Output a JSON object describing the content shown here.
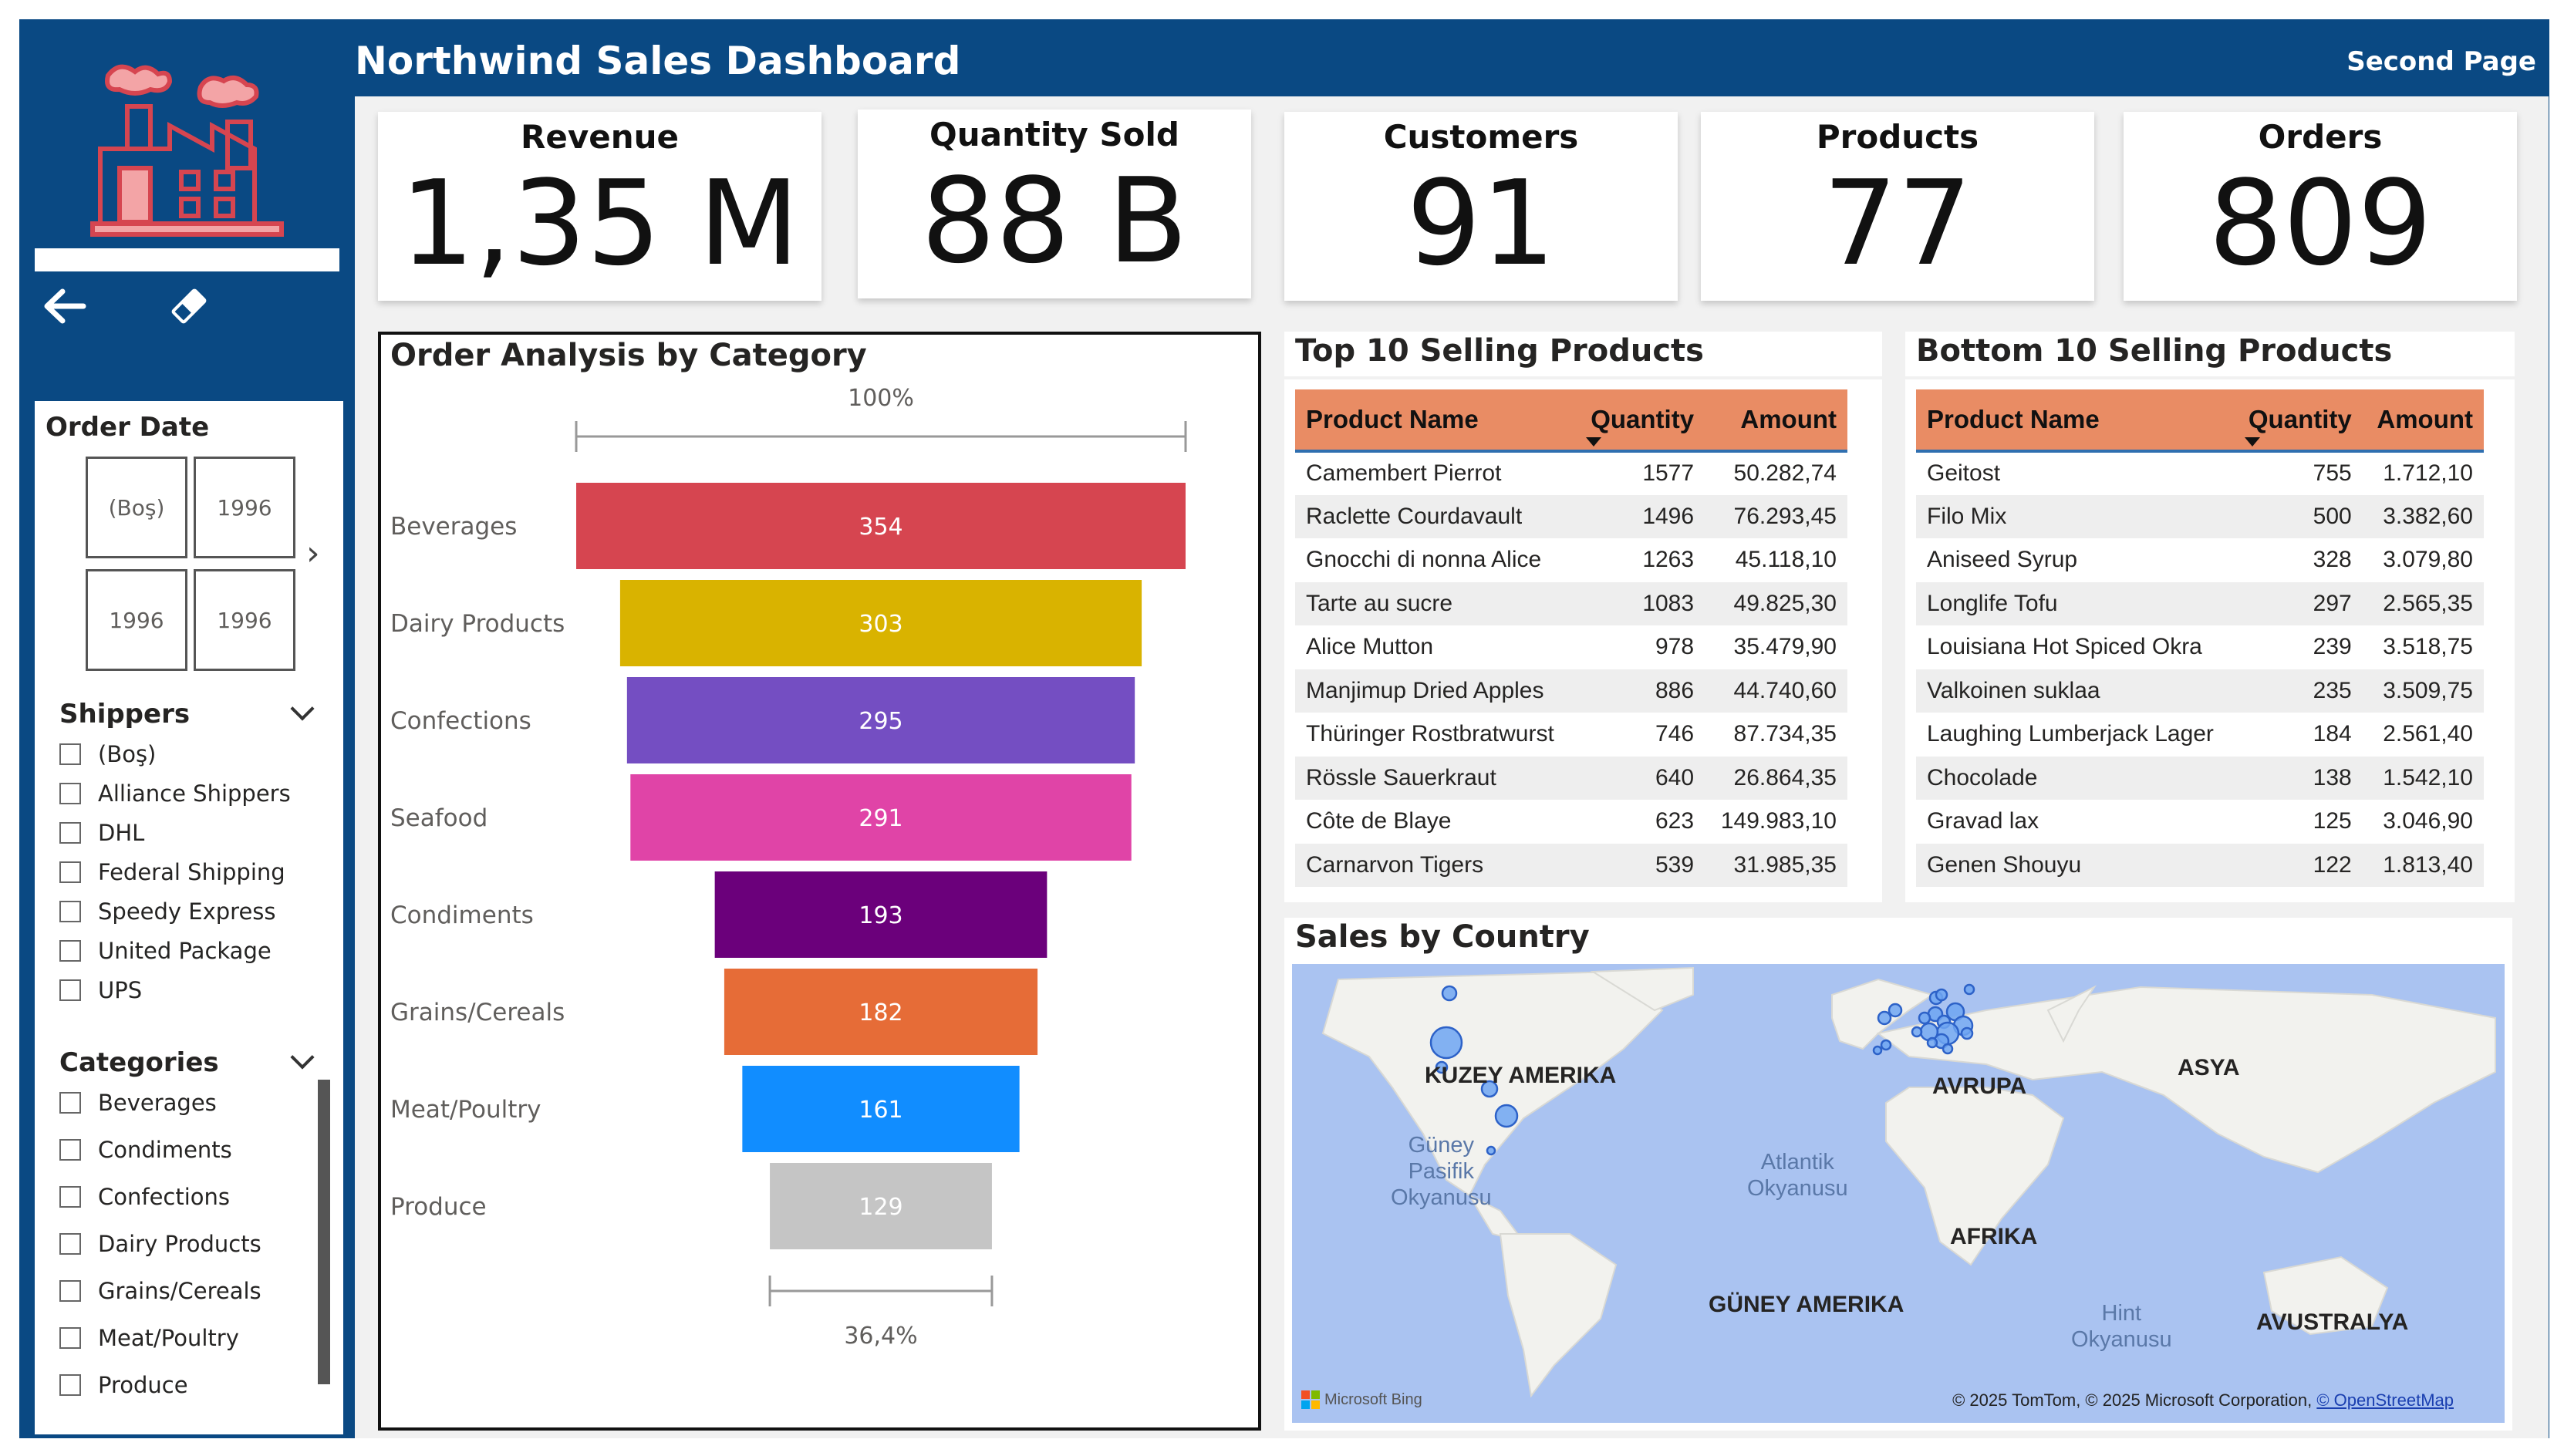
{
  "header": {
    "title": "Northwind Sales Dashboard",
    "page_link": "Second Page"
  },
  "colors": {
    "frame": "#0a4983",
    "header_row": "#e98c64",
    "accent": "#2f6fb0"
  },
  "nav": {
    "back_icon": "arrow-left-icon",
    "clear_icon": "eraser-icon",
    "logo_icon": "factory-icon"
  },
  "slicers": {
    "order_date": {
      "title": "Order Date",
      "tiles": [
        "(Boş)",
        "1996",
        "1996",
        "1996"
      ]
    },
    "shippers": {
      "title": "Shippers",
      "items": [
        "(Boş)",
        "Alliance Shippers",
        "DHL",
        "Federal Shipping",
        "Speedy Express",
        "United Package",
        "UPS"
      ]
    },
    "categories": {
      "title": "Categories",
      "items": [
        "Beverages",
        "Condiments",
        "Confections",
        "Dairy Products",
        "Grains/Cereals",
        "Meat/Poultry",
        "Produce"
      ]
    }
  },
  "kpis": [
    {
      "label": "Revenue",
      "value": "1,35 M"
    },
    {
      "label": "Quantity Sold",
      "value": "88 B"
    },
    {
      "label": "Customers",
      "value": "91"
    },
    {
      "label": "Products",
      "value": "77"
    },
    {
      "label": "Orders",
      "value": "809"
    }
  ],
  "funnel": {
    "title": "Order Analysis by Category",
    "top_label": "100%",
    "bottom_label": "36,4%",
    "chart_data": {
      "type": "bar",
      "categories": [
        "Beverages",
        "Dairy Products",
        "Confections",
        "Seafood",
        "Condiments",
        "Grains/Cereals",
        "Meat/Poultry",
        "Produce"
      ],
      "values": [
        354,
        303,
        295,
        291,
        193,
        182,
        161,
        129
      ],
      "colors": [
        "#d64550",
        "#d9b300",
        "#744ec2",
        "#e044a7",
        "#6b007b",
        "#e66c37",
        "#118dff",
        "#c5c5c5"
      ]
    }
  },
  "top10": {
    "title": "Top 10 Selling Products",
    "columns": [
      "Product Name",
      "Quantity",
      "Amount"
    ],
    "rows": [
      [
        "Camembert Pierrot",
        "1577",
        "50.282,74"
      ],
      [
        "Raclette Courdavault",
        "1496",
        "76.293,45"
      ],
      [
        "Gnocchi di nonna Alice",
        "1263",
        "45.118,10"
      ],
      [
        "Tarte au sucre",
        "1083",
        "49.825,30"
      ],
      [
        "Alice Mutton",
        "978",
        "35.479,90"
      ],
      [
        "Manjimup Dried Apples",
        "886",
        "44.740,60"
      ],
      [
        "Thüringer Rostbratwurst",
        "746",
        "87.734,35"
      ],
      [
        "Rössle Sauerkraut",
        "640",
        "26.864,35"
      ],
      [
        "Côte de Blaye",
        "623",
        "149.983,10"
      ],
      [
        "Carnarvon Tigers",
        "539",
        "31.985,35"
      ]
    ]
  },
  "bottom10": {
    "title": "Bottom 10 Selling Products",
    "columns": [
      "Product Name",
      "Quantity",
      "Amount"
    ],
    "rows": [
      [
        "Geitost",
        "755",
        "1.712,10"
      ],
      [
        "Filo Mix",
        "500",
        "3.382,60"
      ],
      [
        "Aniseed Syrup",
        "328",
        "3.079,80"
      ],
      [
        "Longlife Tofu",
        "297",
        "2.565,35"
      ],
      [
        "Louisiana Hot Spiced Okra",
        "239",
        "3.518,75"
      ],
      [
        "Valkoinen suklaa",
        "235",
        "3.509,75"
      ],
      [
        "Laughing Lumberjack Lager",
        "184",
        "2.561,40"
      ],
      [
        "Chocolade",
        "138",
        "1.542,10"
      ],
      [
        "Gravad lax",
        "125",
        "3.046,90"
      ],
      [
        "Genen Shouyu",
        "122",
        "1.813,40"
      ]
    ]
  },
  "map": {
    "title": "Sales by Country",
    "continents": [
      "KUZEY AMERIKA",
      "AVRUPA",
      "ASYA",
      "AFRIKA",
      "GÜNEY AMERIKA",
      "AVUSTRALYA"
    ],
    "oceans": [
      "Güney\nPasifik\nOkyanusu",
      "Atlantik\nOkyanusu",
      "Hint\nOkyanusu"
    ],
    "attribution": "© 2025 TomTom, © 2025 Microsoft Corporation,",
    "attribution_link": "© OpenStreetMap",
    "provider": "Microsoft Bing"
  }
}
